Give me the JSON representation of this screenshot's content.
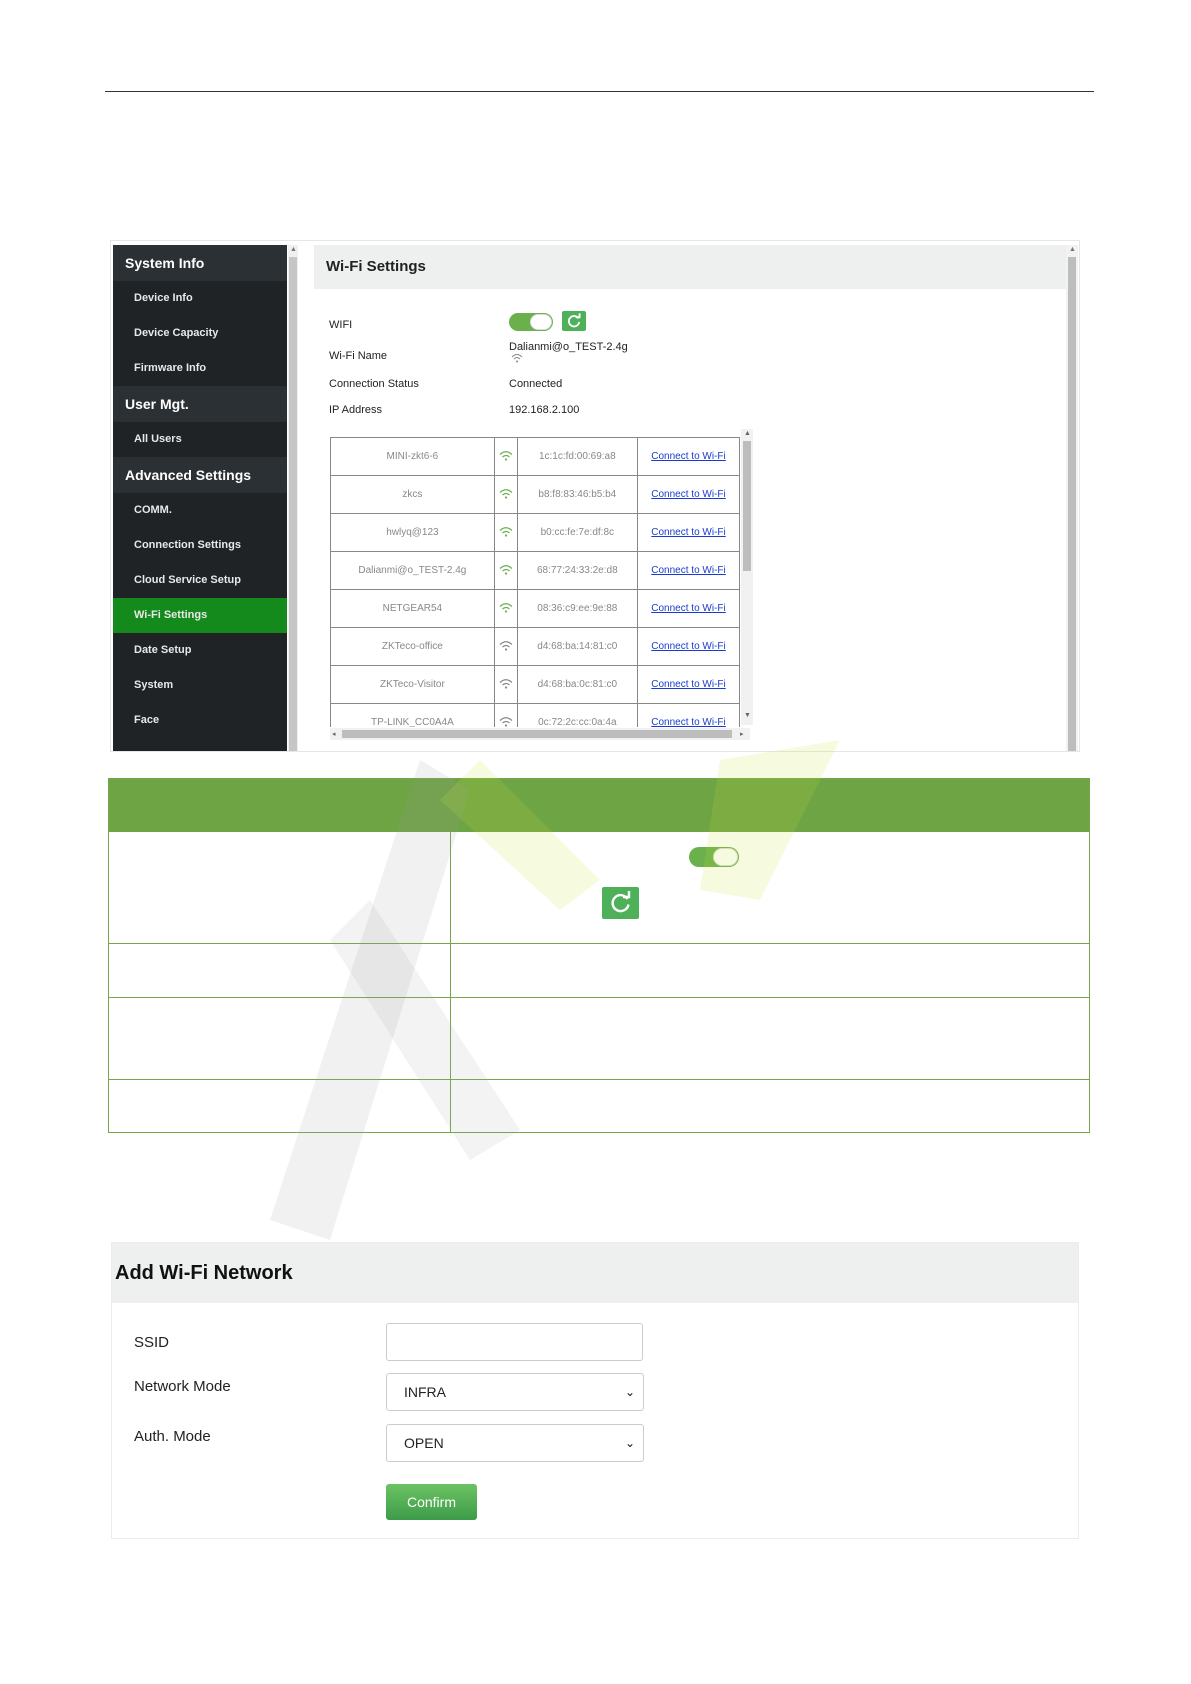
{
  "sidebar": {
    "groups": [
      {
        "label": "System Info",
        "items": [
          "Device Info",
          "Device Capacity",
          "Firmware Info"
        ]
      },
      {
        "label": "User Mgt.",
        "items": [
          "All Users"
        ]
      },
      {
        "label": "Advanced Settings",
        "items": [
          "COMM.",
          "Connection Settings",
          "Cloud Service Setup",
          "Wi-Fi Settings",
          "Date Setup",
          "System",
          "Face"
        ]
      }
    ],
    "active_item": "Wi-Fi Settings"
  },
  "wifi_settings": {
    "title": "Wi-Fi Settings",
    "wifi_label": "WIFI",
    "wifi_enabled": true,
    "name_label": "Wi-Fi Name",
    "name_value": "Dalianmi@o_TEST-2.4g",
    "status_label": "Connection Status",
    "status_value": "Connected",
    "ip_label": "IP Address",
    "ip_value": "192.168.2.100",
    "networks": [
      {
        "ssid": "MINI-zkt6-6",
        "mac": "1c:1c:fd:00:69:a8",
        "action": "Connect to Wi-Fi",
        "signal": "strong"
      },
      {
        "ssid": "zkcs",
        "mac": "b8:f8:83:46:b5:b4",
        "action": "Connect to Wi-Fi",
        "signal": "strong"
      },
      {
        "ssid": "hwlyq@123",
        "mac": "b0:cc:fe:7e:df:8c",
        "action": "Connect to Wi-Fi",
        "signal": "strong"
      },
      {
        "ssid": "Dalianmi@o_TEST-2.4g",
        "mac": "68:77:24:33:2e:d8",
        "action": "Connect to Wi-Fi",
        "signal": "strong"
      },
      {
        "ssid": "NETGEAR54",
        "mac": "08:36:c9:ee:9e:88",
        "action": "Connect to Wi-Fi",
        "signal": "strong"
      },
      {
        "ssid": "ZKTeco-office",
        "mac": "d4:68:ba:14:81:c0",
        "action": "Connect to Wi-Fi",
        "signal": "weak"
      },
      {
        "ssid": "ZKTeco-Visitor",
        "mac": "d4:68:ba:0c:81:c0",
        "action": "Connect to Wi-Fi",
        "signal": "weak"
      },
      {
        "ssid": "TP-LINK_CC0A4A",
        "mac": "0c:72:2c:cc:0a:4a",
        "action": "Connect to Wi-Fi",
        "signal": "weak"
      }
    ]
  },
  "add_network": {
    "title": "Add Wi-Fi Network",
    "ssid_label": "SSID",
    "ssid_value": "",
    "mode_label": "Network Mode",
    "mode_value": "INFRA",
    "auth_label": "Auth. Mode",
    "auth_value": "OPEN",
    "confirm_label": "Confirm"
  },
  "colors": {
    "accent_green": "#6fa445",
    "sidebar_bg": "#1f2326",
    "active_item": "#138a1b",
    "link_blue": "#1a3bd0"
  }
}
